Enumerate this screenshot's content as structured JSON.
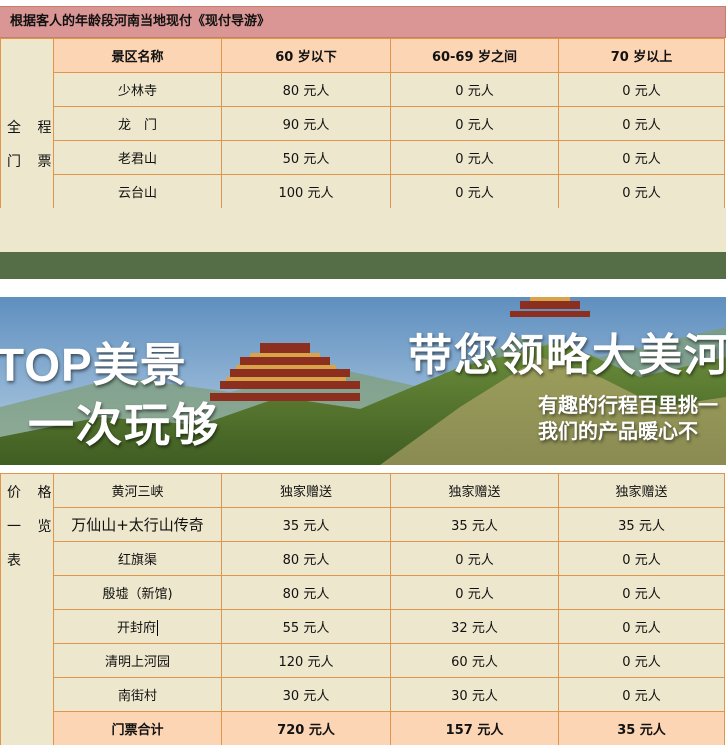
{
  "section1": {
    "title": "根据客人的年龄段河南当地现付《现付导游》",
    "side_label": [
      "全 程",
      "门 票"
    ],
    "headers": [
      "景区名称",
      "60 岁以下",
      "60-69 岁之间",
      "70 岁以上"
    ],
    "rows": [
      [
        "少林寺",
        "80 元人",
        "0 元人",
        "0 元人"
      ],
      [
        "龙　门",
        "90 元人",
        "0 元人",
        "0 元人"
      ],
      [
        "老君山",
        "50 元人",
        "0 元人",
        "0 元人"
      ],
      [
        "云台山",
        "100 元人",
        "0 元人",
        "0 元人"
      ]
    ]
  },
  "banner": {
    "line1": "TOP美景",
    "line2": "一次玩够",
    "headline": "带您领略大美河南",
    "sub1": "有趣的行程百里挑一",
    "sub2": "我们的产品暖心不"
  },
  "section2": {
    "side_label": [
      "价 格",
      "一 览",
      "表"
    ],
    "rows": [
      [
        "黄河三峡",
        "独家赠送",
        "独家赠送",
        "独家赠送"
      ],
      [
        "万仙山+太行山传奇",
        "35 元人",
        "35 元人",
        "35 元人"
      ],
      [
        "红旗渠",
        "80 元人",
        "0 元人",
        "0 元人"
      ],
      [
        "殷墟（新馆)",
        "80 元人",
        "0 元人",
        "0 元人"
      ],
      [
        "开封府",
        "55 元人",
        "32 元人",
        "0 元人"
      ],
      [
        "清明上河园",
        "120 元人",
        "60 元人",
        "0 元人"
      ],
      [
        "南街村",
        "30 元人",
        "30 元人",
        "0 元人"
      ]
    ],
    "total": [
      "门票合计",
      "720 元人",
      "157 元人",
      "35 元人"
    ]
  },
  "colors": {
    "title_bg": "#da9694",
    "cell_bg": "#ede7cd",
    "header_bg": "#fbd5b4",
    "border": "#e0954a",
    "green_band": "#566e47"
  }
}
